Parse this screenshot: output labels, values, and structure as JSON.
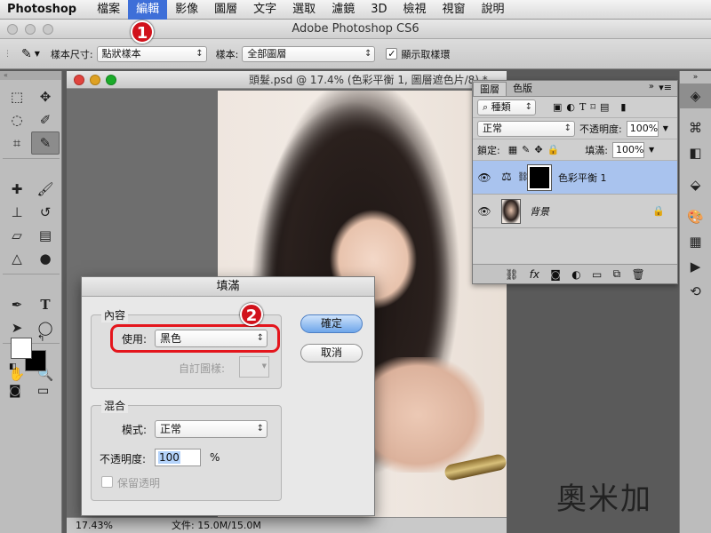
{
  "menubar": {
    "app": "Photoshop",
    "items": [
      "檔案",
      "編輯",
      "影像",
      "圖層",
      "文字",
      "選取",
      "濾鏡",
      "3D",
      "檢視",
      "視窗",
      "說明"
    ],
    "active_index": 1
  },
  "window": {
    "title": "Adobe Photoshop CS6"
  },
  "options": {
    "sample_size_label": "樣本尺寸:",
    "sample_size_value": "點狀樣本",
    "sample_label": "樣本:",
    "sample_value": "全部圖層",
    "show_ring_label": "顯示取樣環",
    "show_ring_checked": true
  },
  "document": {
    "title": "頭髮.psd @ 17.4% (色彩平衡 1, 圖層遮色片/8) *",
    "zoom": "17.43%",
    "file_info": "文件: 15.0M/15.0M"
  },
  "layers_panel": {
    "tabs": [
      "圖層",
      "色版"
    ],
    "filter_label": "種類",
    "blend_mode": "正常",
    "opacity_label": "不透明度:",
    "opacity_value": "100%",
    "lock_label": "鎖定:",
    "fill_label": "填滿:",
    "fill_value": "100%",
    "layers": [
      {
        "name": "色彩平衡 1",
        "selected": true
      },
      {
        "name": "背景",
        "selected": false,
        "locked": true
      }
    ]
  },
  "fill_dialog": {
    "title": "填滿",
    "contents_group": "內容",
    "use_label": "使用:",
    "use_value": "黑色",
    "custom_pattern_label": "自訂圖樣:",
    "blending_group": "混合",
    "mode_label": "模式:",
    "mode_value": "正常",
    "opacity_label": "不透明度:",
    "opacity_value": "100",
    "opacity_unit": "%",
    "preserve_label": "保留透明",
    "ok_label": "確定",
    "cancel_label": "取消"
  },
  "annotations": {
    "step1": "1",
    "step2": "2"
  },
  "watermark": {
    "text": "奧米加"
  },
  "colors": {
    "menu_highlight": "#3e6fd8",
    "selected_layer": "#a9c3ee",
    "annotation_red": "#d1121b"
  }
}
